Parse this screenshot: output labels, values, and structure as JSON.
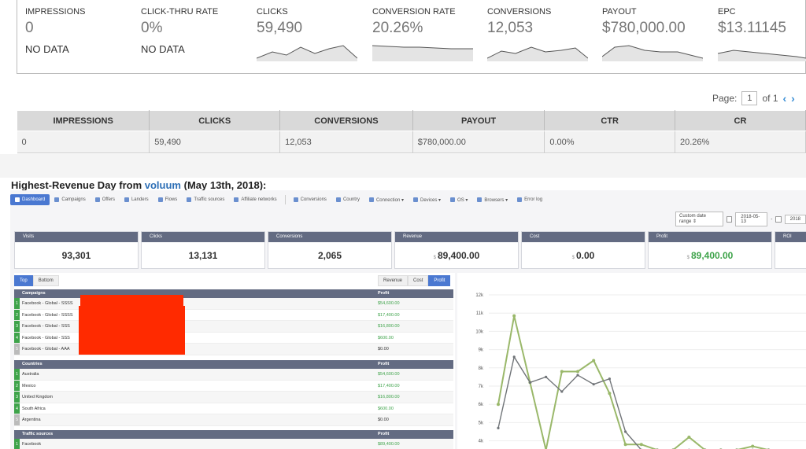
{
  "stats": [
    {
      "label": "IMPRESSIONS",
      "value": "0",
      "nodata": "NO DATA"
    },
    {
      "label": "CLICK-THRU RATE",
      "value": "0%",
      "nodata": "NO DATA"
    },
    {
      "label": "CLICKS",
      "value": "59,490"
    },
    {
      "label": "CONVERSION RATE",
      "value": "20.26%"
    },
    {
      "label": "CONVERSIONS",
      "value": "12,053"
    },
    {
      "label": "PAYOUT",
      "value": "$780,000.00"
    },
    {
      "label": "EPC",
      "value": "$13.11145"
    }
  ],
  "pager": {
    "label": "Page:",
    "current": "1",
    "of": "of 1"
  },
  "summary": {
    "headers": [
      "IMPRESSIONS",
      "CLICKS",
      "CONVERSIONS",
      "PAYOUT",
      "CTR",
      "CR"
    ],
    "row": [
      "0",
      "59,490",
      "12,053",
      "$780,000.00",
      "0.00%",
      "20.26%"
    ]
  },
  "heading": {
    "prefix": "Highest-Revenue Day from ",
    "brand": "voluum",
    "suffix": " (May 13th, 2018):"
  },
  "voluum": {
    "nav": [
      "Dashboard",
      "Campaigns",
      "Offers",
      "Landers",
      "Flows",
      "Traffic sources",
      "Affiliate networks",
      "Conversions",
      "Country",
      "Connection ▾",
      "Devices ▾",
      "OS ▾",
      "Browsers ▾",
      "Error log"
    ],
    "date_range_label": "Custom date range ⇕",
    "date_from": "2018-05-13",
    "date_to": "2018",
    "date_sep": "-",
    "kpis": [
      {
        "label": "Visits",
        "value": "93,301"
      },
      {
        "label": "Clicks",
        "value": "13,131"
      },
      {
        "label": "Conversions",
        "value": "2,065"
      },
      {
        "label": "Revenue",
        "value": "89,400.00",
        "dollar": "$"
      },
      {
        "label": "Cost",
        "value": "0.00",
        "dollar": "$"
      },
      {
        "label": "Profit",
        "value": "89,400.00",
        "dollar": "$"
      },
      {
        "label": "ROI",
        "value": ""
      }
    ],
    "toggle_left": [
      "Top",
      "Bottom"
    ],
    "toggle_right": [
      "Revenue",
      "Cost",
      "Profit"
    ],
    "tables": [
      {
        "title": "Campaigns",
        "col": "Profit",
        "rows": [
          {
            "rank": "1",
            "name": "Facebook - Global - SSSS",
            "profit": "$54,600.00"
          },
          {
            "rank": "2",
            "name": "Facebook - Global - SSSS",
            "profit": "$17,400.00"
          },
          {
            "rank": "3",
            "name": "Facebook - Global - SSS",
            "profit": "$16,800.00"
          },
          {
            "rank": "4",
            "name": "Facebook - Global - SSS",
            "profit": "$600.00"
          },
          {
            "rank": "5",
            "name": "Facebook - Global - AAA",
            "profit": "$0.00"
          }
        ]
      },
      {
        "title": "Countries",
        "col": "Profit",
        "rows": [
          {
            "rank": "1",
            "name": "Australia",
            "profit": "$54,600.00"
          },
          {
            "rank": "2",
            "name": "Mexico",
            "profit": "$17,400.00"
          },
          {
            "rank": "3",
            "name": "United Kingdom",
            "profit": "$16,800.00"
          },
          {
            "rank": "4",
            "name": "South Africa",
            "profit": "$600.00"
          },
          {
            "rank": "5",
            "name": "Argentina",
            "profit": "$0.00"
          }
        ]
      },
      {
        "title": "Traffic sources",
        "col": "Profit",
        "rows": [
          {
            "rank": "1",
            "name": "Facebook",
            "profit": "$89,400.00"
          }
        ]
      }
    ],
    "chart_data": {
      "type": "line",
      "y_ticks": [
        "12k",
        "11k",
        "10k",
        "9k",
        "8k",
        "7k",
        "6k",
        "5k",
        "4k"
      ],
      "ylim": [
        3500,
        12500
      ],
      "series": [
        {
          "color": "#9ab86a",
          "values": [
            6000,
            10850,
            7200,
            3500,
            7800,
            7800,
            8400,
            6600,
            3800,
            3800,
            3500,
            3500,
            4200,
            3500,
            3500,
            3500,
            3700,
            3500
          ]
        },
        {
          "color": "#707478",
          "values": [
            4700,
            8600,
            7200,
            7500,
            6700,
            7600,
            7100,
            7400,
            4500,
            3500,
            3500,
            3500,
            3500,
            3500,
            3500,
            3500,
            3500,
            3500
          ]
        }
      ]
    }
  },
  "colors": {
    "accent": "#4a78d1",
    "header": "#636b82",
    "green": "#3ea34a",
    "redaction": "#ff2a00"
  }
}
